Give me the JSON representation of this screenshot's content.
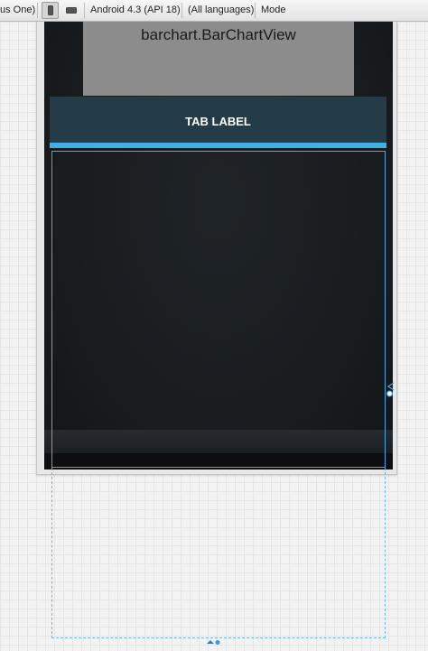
{
  "toolbar": {
    "device_label": "us One)",
    "api_label": "Android 4.3 (API 18)",
    "language_label": "(All languages)",
    "mode_label": "Mode"
  },
  "preview": {
    "chart_view_label": "barchart.BarChartView",
    "tab_label": "TAB LABEL"
  },
  "colors": {
    "tab_background": "#243b48",
    "tab_indicator": "#3fb2e3",
    "selection": "#4aa9df",
    "chart_view_background": "#8c8c8c"
  },
  "icons": {
    "portrait": "portrait-orientation-icon",
    "landscape": "landscape-orientation-icon",
    "resize_right": "resize-handle-icon",
    "resize_bottom": "resize-handle-icon"
  }
}
